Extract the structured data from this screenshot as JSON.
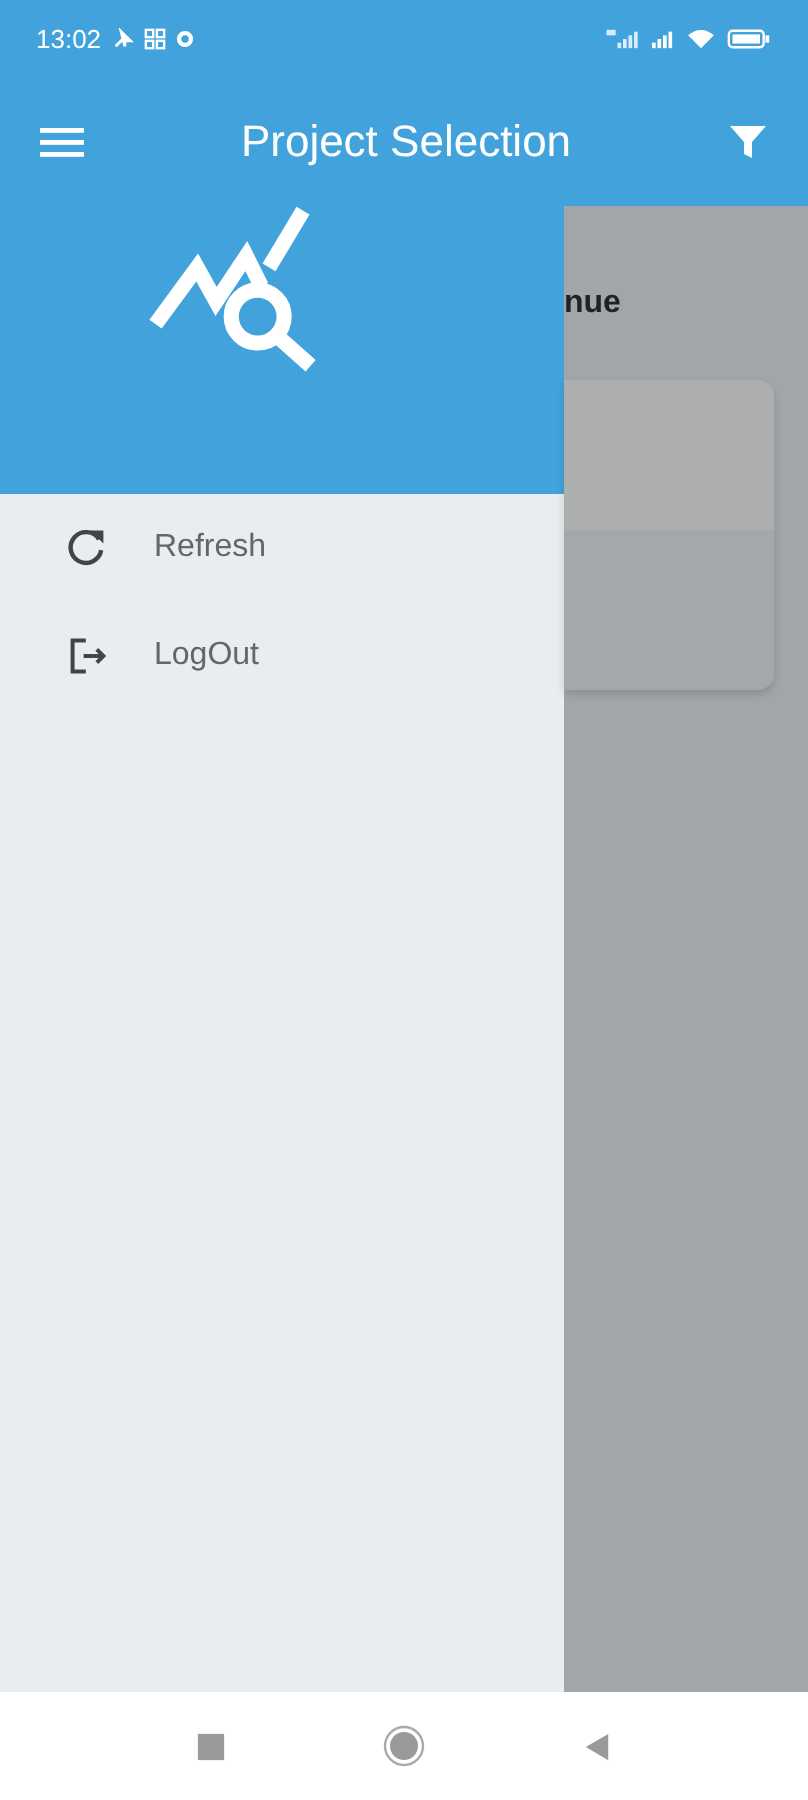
{
  "status_bar": {
    "time": "13:02"
  },
  "app_bar": {
    "title": "Project Selection"
  },
  "drawer": {
    "items": [
      {
        "kind": "refresh",
        "label": "Refresh"
      },
      {
        "kind": "logout",
        "label": "LogOut"
      }
    ]
  },
  "background": {
    "heading": "nue"
  }
}
